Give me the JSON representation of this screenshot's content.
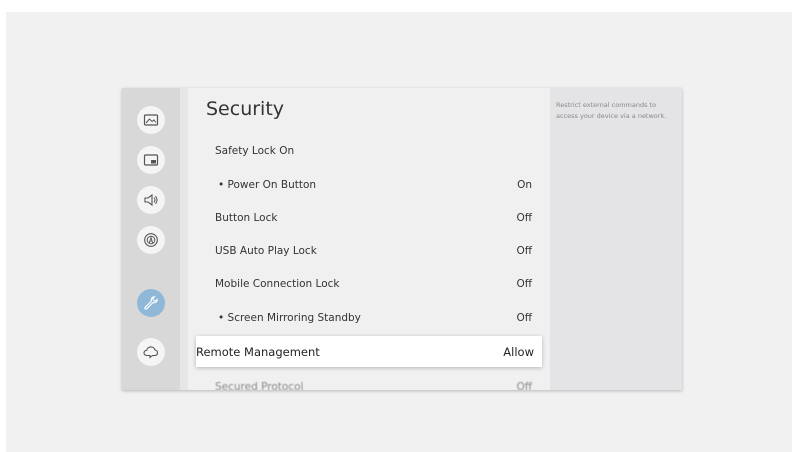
{
  "sidebar": {
    "items": [
      {
        "icon": "picture-icon"
      },
      {
        "icon": "picture-in-picture-icon"
      },
      {
        "icon": "sound-icon"
      },
      {
        "icon": "broadcasting-icon"
      },
      {
        "icon": "wrench-icon",
        "active": true
      },
      {
        "icon": "support-icon"
      }
    ]
  },
  "main": {
    "title": "Security",
    "rows": [
      {
        "label": "Safety Lock On",
        "value": ""
      },
      {
        "label": "•  Power On Button",
        "value": "On"
      },
      {
        "label": "Button Lock",
        "value": "Off"
      },
      {
        "label": "USB Auto Play Lock",
        "value": "Off"
      },
      {
        "label": "Mobile Connection Lock",
        "value": "Off"
      },
      {
        "label": "•  Screen Mirroring Standby",
        "value": "Off"
      },
      {
        "label": "Remote Management",
        "value": "Allow"
      },
      {
        "label": "Secured Protocol",
        "value": "Off"
      }
    ]
  },
  "help": {
    "text": "Restrict external commands to access your device via a network."
  },
  "colors": {
    "accent": "#8fb8d8",
    "rail": "#d8d8d8",
    "panel": "#f0f0f0"
  }
}
